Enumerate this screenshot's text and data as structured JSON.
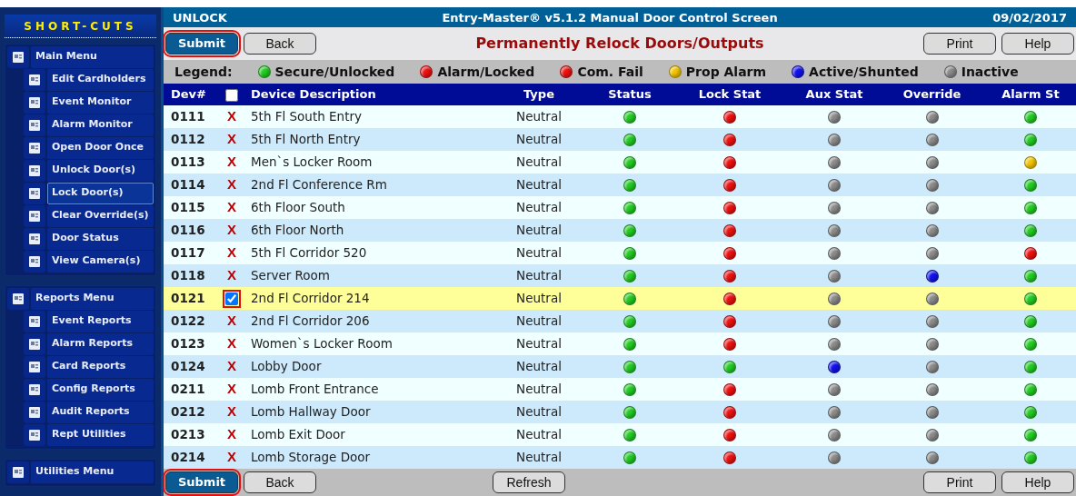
{
  "sidebar": {
    "title": "SHORT-CUTS",
    "groups": [
      {
        "label": "Main Menu",
        "items": [
          {
            "label": "Edit Cardholders",
            "selected": false
          },
          {
            "label": "Event Monitor",
            "selected": false
          },
          {
            "label": "Alarm Monitor",
            "selected": false
          },
          {
            "label": "Open Door Once",
            "selected": false
          },
          {
            "label": "Unlock Door(s)",
            "selected": false
          },
          {
            "label": "Lock Door(s)",
            "selected": true
          },
          {
            "label": "Clear Override(s)",
            "selected": false
          },
          {
            "label": "Door Status",
            "selected": false
          },
          {
            "label": "View Camera(s)",
            "selected": false
          }
        ]
      },
      {
        "label": "Reports Menu",
        "items": [
          {
            "label": "Event Reports",
            "selected": false
          },
          {
            "label": "Alarm Reports",
            "selected": false
          },
          {
            "label": "Card Reports",
            "selected": false
          },
          {
            "label": "Config Reports",
            "selected": false
          },
          {
            "label": "Audit Reports",
            "selected": false
          },
          {
            "label": "Rept Utilities",
            "selected": false
          }
        ]
      },
      {
        "label": "Utilities Menu"
      }
    ]
  },
  "title_bar": {
    "left": "UNLOCK",
    "center": "Entry-Master® v5.1.2 Manual Door Control Screen",
    "right": "09/02/2017"
  },
  "toolbar": {
    "buttons_left": [
      {
        "label": "Submit",
        "kind": "primary"
      },
      {
        "label": "Back",
        "kind": "plain"
      }
    ],
    "heading": "Permanently Relock Doors/Outputs",
    "buttons_right": [
      {
        "label": "Print",
        "kind": "plain"
      },
      {
        "label": "Help",
        "kind": "plain"
      }
    ]
  },
  "legend": {
    "label": "Legend:",
    "items": [
      {
        "label": "Secure/Unlocked",
        "color": "#22cc22"
      },
      {
        "label": "Alarm/Locked",
        "color": "#ee1111"
      },
      {
        "label": "Com. Fail",
        "color": "#ee1111"
      },
      {
        "label": "Prop Alarm",
        "color": "#f2c400"
      },
      {
        "label": "Active/Shunted",
        "color": "#1111ee"
      },
      {
        "label": "Inactive",
        "color": "#8a8a8a"
      }
    ]
  },
  "table": {
    "columns": [
      "Dev#",
      "Device Description",
      "Type",
      "Status",
      "Lock Stat",
      "Aux Stat",
      "Override",
      "Alarm St"
    ],
    "select_all_checked": false,
    "rows": [
      {
        "dev": "0111",
        "checked": false,
        "mark": "X",
        "description": "5th Fl South Entry",
        "type": "Neutral",
        "lights": [
          {
            "color": "#22cc22"
          },
          {
            "color": "#ee1111"
          },
          {
            "color": "#8a8a8a"
          },
          {
            "color": "#8a8a8a"
          },
          {
            "color": "#22cc22"
          }
        ]
      },
      {
        "dev": "0112",
        "checked": false,
        "mark": "X",
        "description": "5th Fl North Entry",
        "type": "Neutral",
        "lights": [
          {
            "color": "#22cc22"
          },
          {
            "color": "#ee1111"
          },
          {
            "color": "#8a8a8a"
          },
          {
            "color": "#8a8a8a"
          },
          {
            "color": "#22cc22"
          }
        ]
      },
      {
        "dev": "0113",
        "checked": false,
        "mark": "X",
        "description": "Men`s Locker Room",
        "type": "Neutral",
        "lights": [
          {
            "color": "#22cc22"
          },
          {
            "color": "#ee1111"
          },
          {
            "color": "#8a8a8a"
          },
          {
            "color": "#8a8a8a"
          },
          {
            "color": "#f2c400"
          }
        ]
      },
      {
        "dev": "0114",
        "checked": false,
        "mark": "X",
        "description": "2nd Fl Conference Rm",
        "type": "Neutral",
        "lights": [
          {
            "color": "#22cc22"
          },
          {
            "color": "#ee1111"
          },
          {
            "color": "#8a8a8a"
          },
          {
            "color": "#8a8a8a"
          },
          {
            "color": "#22cc22"
          }
        ]
      },
      {
        "dev": "0115",
        "checked": false,
        "mark": "X",
        "description": "6th Floor South",
        "type": "Neutral",
        "lights": [
          {
            "color": "#22cc22"
          },
          {
            "color": "#ee1111"
          },
          {
            "color": "#8a8a8a"
          },
          {
            "color": "#8a8a8a"
          },
          {
            "color": "#22cc22"
          }
        ]
      },
      {
        "dev": "0116",
        "checked": false,
        "mark": "X",
        "description": "6th Floor North",
        "type": "Neutral",
        "lights": [
          {
            "color": "#22cc22"
          },
          {
            "color": "#ee1111"
          },
          {
            "color": "#8a8a8a"
          },
          {
            "color": "#8a8a8a"
          },
          {
            "color": "#22cc22"
          }
        ]
      },
      {
        "dev": "0117",
        "checked": false,
        "mark": "X",
        "description": "5th Fl Corridor 520",
        "type": "Neutral",
        "lights": [
          {
            "color": "#22cc22"
          },
          {
            "color": "#ee1111"
          },
          {
            "color": "#8a8a8a"
          },
          {
            "color": "#8a8a8a"
          },
          {
            "color": "#ee1111"
          }
        ]
      },
      {
        "dev": "0118",
        "checked": false,
        "mark": "X",
        "description": "Server Room",
        "type": "Neutral",
        "lights": [
          {
            "color": "#22cc22"
          },
          {
            "color": "#ee1111"
          },
          {
            "color": "#8a8a8a"
          },
          {
            "color": "#1111ee"
          },
          {
            "color": "#22cc22"
          }
        ]
      },
      {
        "dev": "0121",
        "checked": true,
        "description": "2nd Fl Corridor 214",
        "type": "Neutral",
        "lights": [
          {
            "color": "#22cc22"
          },
          {
            "color": "#ee1111"
          },
          {
            "color": "#8a8a8a"
          },
          {
            "color": "#8a8a8a"
          },
          {
            "color": "#22cc22"
          }
        ]
      },
      {
        "dev": "0122",
        "checked": false,
        "mark": "X",
        "description": "2nd Fl Corridor 206",
        "type": "Neutral",
        "lights": [
          {
            "color": "#22cc22"
          },
          {
            "color": "#ee1111"
          },
          {
            "color": "#8a8a8a"
          },
          {
            "color": "#8a8a8a"
          },
          {
            "color": "#22cc22"
          }
        ]
      },
      {
        "dev": "0123",
        "checked": false,
        "mark": "X",
        "description": "Women`s Locker Room",
        "type": "Neutral",
        "lights": [
          {
            "color": "#22cc22"
          },
          {
            "color": "#ee1111"
          },
          {
            "color": "#8a8a8a"
          },
          {
            "color": "#8a8a8a"
          },
          {
            "color": "#22cc22"
          }
        ]
      },
      {
        "dev": "0124",
        "checked": false,
        "mark": "X",
        "description": "Lobby Door",
        "type": "Neutral",
        "lights": [
          {
            "color": "#22cc22"
          },
          {
            "color": "#22cc22"
          },
          {
            "color": "#1111ee"
          },
          {
            "color": "#8a8a8a"
          },
          {
            "color": "#22cc22"
          }
        ]
      },
      {
        "dev": "0211",
        "checked": false,
        "mark": "X",
        "description": "Lomb Front Entrance",
        "type": "Neutral",
        "lights": [
          {
            "color": "#22cc22"
          },
          {
            "color": "#ee1111"
          },
          {
            "color": "#8a8a8a"
          },
          {
            "color": "#8a8a8a"
          },
          {
            "color": "#22cc22"
          }
        ]
      },
      {
        "dev": "0212",
        "checked": false,
        "mark": "X",
        "description": "Lomb Hallway Door",
        "type": "Neutral",
        "lights": [
          {
            "color": "#22cc22"
          },
          {
            "color": "#ee1111"
          },
          {
            "color": "#8a8a8a"
          },
          {
            "color": "#8a8a8a"
          },
          {
            "color": "#22cc22"
          }
        ]
      },
      {
        "dev": "0213",
        "checked": false,
        "mark": "X",
        "description": "Lomb Exit Door",
        "type": "Neutral",
        "lights": [
          {
            "color": "#22cc22"
          },
          {
            "color": "#ee1111"
          },
          {
            "color": "#8a8a8a"
          },
          {
            "color": "#8a8a8a"
          },
          {
            "color": "#22cc22"
          }
        ]
      },
      {
        "dev": "0214",
        "checked": false,
        "mark": "X",
        "description": "Lomb Storage Door",
        "type": "Neutral",
        "lights": [
          {
            "color": "#22cc22"
          },
          {
            "color": "#ee1111"
          },
          {
            "color": "#8a8a8a"
          },
          {
            "color": "#8a8a8a"
          },
          {
            "color": "#22cc22"
          }
        ]
      }
    ]
  },
  "footer": {
    "buttons_left": [
      {
        "label": "Submit",
        "kind": "primary"
      },
      {
        "label": "Back",
        "kind": "plain"
      }
    ],
    "buttons_center": [
      {
        "label": "Refresh",
        "kind": "plain"
      }
    ],
    "buttons_right": [
      {
        "label": "Print",
        "kind": "plain"
      },
      {
        "label": "Help",
        "kind": "plain"
      }
    ]
  }
}
